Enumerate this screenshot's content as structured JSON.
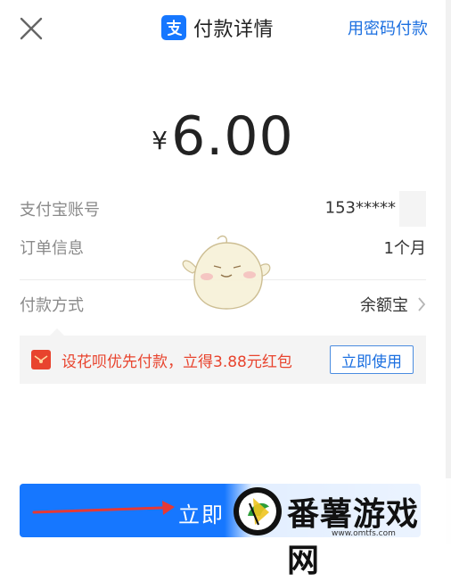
{
  "header": {
    "close_icon": "close-icon",
    "brand_icon": "alipay-logo-icon",
    "title": "付款详情",
    "password_pay_link": "用密码付款"
  },
  "amount": {
    "currency_symbol": "¥",
    "value": "6.00"
  },
  "info_rows": [
    {
      "label": "支付宝账号",
      "value": "153*****"
    },
    {
      "label": "订单信息",
      "value": "1个月"
    },
    {
      "label": "付款方式",
      "value": "余额宝"
    }
  ],
  "promo": {
    "icon": "red-packet-icon",
    "text": "设花呗优先付款，立得3.88元红包",
    "button_label": "立即使用"
  },
  "pay_button": {
    "label": "立即"
  },
  "watermark": {
    "brand_text": "番薯游戏网",
    "url": "www.omtfs.com"
  },
  "colors": {
    "accent_blue": "#1677ff",
    "link_blue": "#1b6fe0",
    "promo_red": "#e8442e",
    "arrow_red": "#e53935"
  }
}
